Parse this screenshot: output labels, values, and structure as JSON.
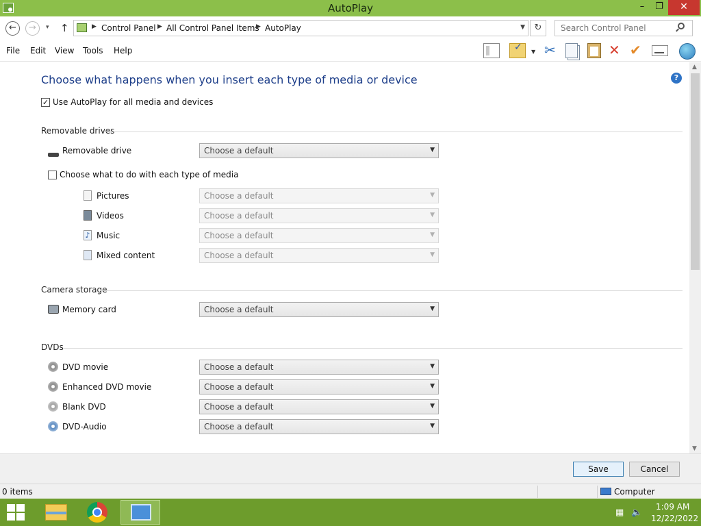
{
  "window": {
    "title": "AutoPlay",
    "minimize": "–",
    "maximize": "❐",
    "close": "✕"
  },
  "nav": {
    "back": "←",
    "forward": "→",
    "dropdown": "▾",
    "up": "↑",
    "refresh": "↻"
  },
  "breadcrumb": [
    "Control Panel",
    "All Control Panel Items",
    "AutoPlay"
  ],
  "search": {
    "placeholder": "Search Control Panel"
  },
  "menu": [
    "File",
    "Edit",
    "View",
    "Tools",
    "Help"
  ],
  "main": {
    "heading": "Choose what happens when you insert each type of media or device",
    "help": "?",
    "use_autoplay": {
      "label": "Use AutoPlay for all media and devices",
      "checked": true
    },
    "sections": {
      "removable": {
        "title": "Removable drives",
        "drive": {
          "label": "Removable drive",
          "value": "Choose a default"
        },
        "per_media": {
          "label": "Choose what to do with each type of media",
          "checked": false
        },
        "media": [
          {
            "label": "Pictures",
            "value": "Choose a default"
          },
          {
            "label": "Videos",
            "value": "Choose a default"
          },
          {
            "label": "Music",
            "value": "Choose a default"
          },
          {
            "label": "Mixed content",
            "value": "Choose a default"
          }
        ]
      },
      "camera": {
        "title": "Camera storage",
        "items": [
          {
            "label": "Memory card",
            "value": "Choose a default"
          }
        ]
      },
      "dvds": {
        "title": "DVDs",
        "items": [
          {
            "label": "DVD movie",
            "value": "Choose a default"
          },
          {
            "label": "Enhanced DVD movie",
            "value": "Choose a default"
          },
          {
            "label": "Blank DVD",
            "value": "Choose a default"
          },
          {
            "label": "DVD-Audio",
            "value": "Choose a default"
          }
        ]
      }
    }
  },
  "buttons": {
    "save": "Save",
    "cancel": "Cancel"
  },
  "status": {
    "items": "0 items",
    "location": "Computer"
  },
  "taskbar": {
    "time": "1:09 AM",
    "date": "12/22/2022"
  },
  "colors": {
    "titlebar": "#8cbf4a",
    "taskbar": "#6d9c2c",
    "heading": "#1e3f8a",
    "accent": "#2e73c6"
  }
}
